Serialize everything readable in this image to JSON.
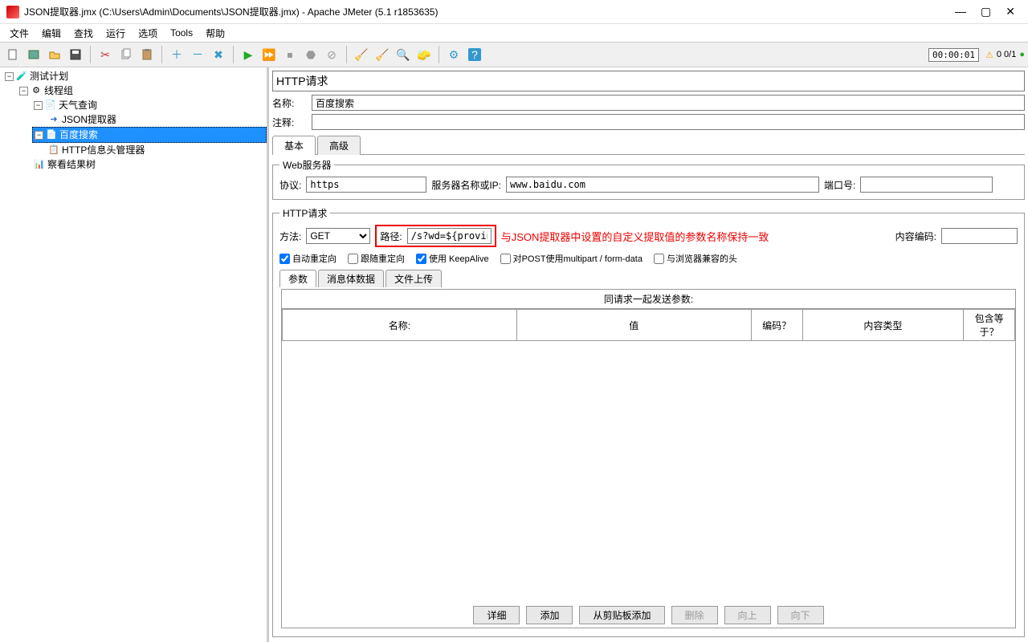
{
  "window": {
    "title": "JSON提取器.jmx (C:\\Users\\Admin\\Documents\\JSON提取器.jmx) - Apache JMeter (5.1 r1853635)"
  },
  "menu": [
    "文件",
    "编辑",
    "查找",
    "运行",
    "选项",
    "Tools",
    "帮助"
  ],
  "timer": "00:00:01",
  "warnings": "0  0/1",
  "tree": {
    "root": "测试计划",
    "threadGroup": "线程组",
    "weatherQuery": "天气查询",
    "jsonExtractor": "JSON提取器",
    "baiduSearch": "百度搜索",
    "httpHeaderMgr": "HTTP信息头管理器",
    "viewResults": "察看结果树"
  },
  "panel": {
    "title": "HTTP请求",
    "nameLabel": "名称:",
    "nameValue": "百度搜索",
    "commentLabel": "注释:",
    "commentValue": "",
    "tabBasic": "基本",
    "tabAdvanced": "高级"
  },
  "webserver": {
    "legend": "Web服务器",
    "protocolLabel": "协议:",
    "protocolValue": "https",
    "serverLabel": "服务器名称或IP:",
    "serverValue": "www.baidu.com",
    "portLabel": "端口号:",
    "portValue": ""
  },
  "httpreq": {
    "legend": "HTTP请求",
    "methodLabel": "方法:",
    "methodValue": "GET",
    "pathLabel": "路径:",
    "pathValue": "/s?wd=${province}",
    "annotation": "与JSON提取器中设置的自定义提取值的参数名称保持一致",
    "encodingLabel": "内容编码:",
    "encodingValue": "",
    "chk1": "自动重定向",
    "chk2": "跟随重定向",
    "chk3": "使用 KeepAlive",
    "chk4": "对POST使用multipart / form-data",
    "chk5": "与浏览器兼容的头"
  },
  "subtabs": {
    "params": "参数",
    "body": "消息体数据",
    "files": "文件上传"
  },
  "paramTable": {
    "caption": "同请求一起发送参数:",
    "cols": [
      "名称:",
      "值",
      "编码？",
      "内容类型",
      "包含等于？"
    ]
  },
  "buttons": {
    "detail": "详细",
    "add": "添加",
    "clipboard": "从剪贴板添加",
    "delete": "删除",
    "up": "向上",
    "down": "向下"
  }
}
